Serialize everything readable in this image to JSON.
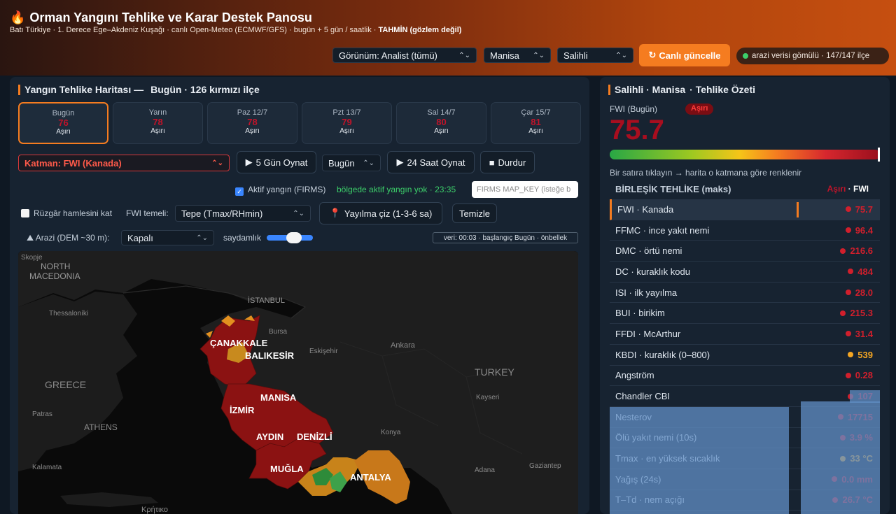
{
  "header": {
    "title": "Orman Yangını Tehlike ve Karar Destek Panosu",
    "subtitle": "Batı Türkiye · 1. Derece Ege–Akdeniz Kuşağı · canlı Open-Meteo (ECMWF/GFS) · bugün + 5 gün / saatlik ·",
    "subtitle_emph": "TAHMİN (gözlem değil)",
    "view_select": "Görünüm: Analist (tümü)",
    "province_select": "Manisa",
    "district_select": "Salihli",
    "refresh_label": "Canlı güncelle",
    "status": "arazi verisi gömülü · 147/147 ilçe"
  },
  "map_panel": {
    "title": "Yangın Tehlike Haritası —",
    "title_detail": "Bugün · 126 kırmızı ilçe",
    "days": [
      {
        "name": "Bugün",
        "value": "76",
        "cls": "Aşırı"
      },
      {
        "name": "Yarın",
        "value": "78",
        "cls": "Aşırı"
      },
      {
        "name": "Paz 12/7",
        "value": "78",
        "cls": "Aşırı"
      },
      {
        "name": "Pzt 13/7",
        "value": "79",
        "cls": "Aşırı"
      },
      {
        "name": "Sal 14/7",
        "value": "80",
        "cls": "Aşırı"
      },
      {
        "name": "Çar 15/7",
        "value": "81",
        "cls": "Aşırı"
      }
    ],
    "layer_select": "Katman: FWI (Kanada)",
    "play5_label": "5 Gün Oynat",
    "day_select": "Bugün",
    "play24_label": "24 Saat Oynat",
    "stop_label": "Durdur",
    "firms_label": "Aktif yangın (FIRMS)",
    "firms_status": "bölgede aktif yangın yok · 23:35",
    "firms_placeholder": "FIRMS MAP_KEY (isteğe b",
    "wind_label": "Rüzgâr hamlesini kat",
    "fwi_base_label": "FWI temeli:",
    "fwi_base_select": "Tepe (Tmax/RHmin)",
    "spread_label": "Yayılma çiz (1-3-6 sa)",
    "clear_label": "Temizle",
    "terrain_label": "Arazi (DEM ~30 m):",
    "terrain_select": "Kapalı",
    "opacity_label": "saydamlık",
    "meta": "veri: 00:03 · başlangıç Bugün · önbellek",
    "map_labels": {
      "north_macedonia_1": "NORTH",
      "north_macedonia_2": "MACEDONIA",
      "skopje": "Skopje",
      "thessaloniki": "Thessaloníki",
      "greece": "GREECE",
      "patras": "Patras",
      "athens": "ATHENS",
      "kalamata": "Kalamata",
      "crete": "Κρήτικο",
      "istanbul": "İSTANBUL",
      "bursa": "Bursa",
      "eskisehir": "Eskişehir",
      "ankara": "Ankara",
      "turkey": "TURKEY",
      "kayseri": "Kayseri",
      "konya": "Konya",
      "adana": "Adana",
      "gaziantep": "Gaziantep",
      "canakkale": "ÇANAKKALE",
      "balikesir": "BALIKESİR",
      "manisa": "MANISA",
      "izmir": "İZMİR",
      "aydin": "AYDIN",
      "denizli": "DENİZLİ",
      "mugla": "MUĞLA",
      "antalya": "ANTALYA"
    }
  },
  "summary_panel": {
    "title": "Salihli · Manisa",
    "title_detail": "· Tehlike Özeti",
    "fwi_label": "FWI (Bugün)",
    "fwi_class": "Aşırı",
    "fwi_value": "75.7",
    "fwi_level_pct": 100,
    "hint": "Bir satıra tıklayın → harita o katmana göre renklenir",
    "combined_title": "BİRLEŞİK TEHLİKE (maks)",
    "combined_class": "Aşırı",
    "combined_sep": "·",
    "combined_index": "FWI",
    "rows": [
      {
        "label": "FWI · Kanada",
        "value": "75.7",
        "color": "#d11f2c"
      },
      {
        "label": "FFMC · ince yakıt nemi",
        "value": "96.4",
        "color": "#d11f2c"
      },
      {
        "label": "DMC · örtü nemi",
        "value": "216.6",
        "color": "#d11f2c"
      },
      {
        "label": "DC · kuraklık kodu",
        "value": "484",
        "color": "#d11f2c"
      },
      {
        "label": "ISI · ilk yayılma",
        "value": "28.0",
        "color": "#d11f2c"
      },
      {
        "label": "BUI · birikim",
        "value": "215.3",
        "color": "#d11f2c"
      },
      {
        "label": "FFDI · McArthur",
        "value": "31.4",
        "color": "#d11f2c"
      },
      {
        "label": "KBDI · kuraklık (0–800)",
        "value": "539",
        "color": "#f5a623"
      },
      {
        "label": "Angström",
        "value": "0.28",
        "color": "#d11f2c"
      },
      {
        "label": "Chandler CBI",
        "value": "107",
        "color": "#d11f2c"
      },
      {
        "label": "Nesterov",
        "value": "17715",
        "color": "#d11f2c"
      },
      {
        "label": "Ölü yakıt nemi (10s)",
        "value": "3.9 %",
        "color": "#d11f2c"
      },
      {
        "label": "Tmax · en yüksek sıcaklık",
        "value": "33 °C",
        "color": "#f5a623"
      },
      {
        "label": "Yağış (24s)",
        "value": "0.0 mm",
        "color": "#d11f2c"
      },
      {
        "label": "T–Td · nem açığı",
        "value": "26.7 °C",
        "color": "#d11f2c"
      }
    ]
  }
}
